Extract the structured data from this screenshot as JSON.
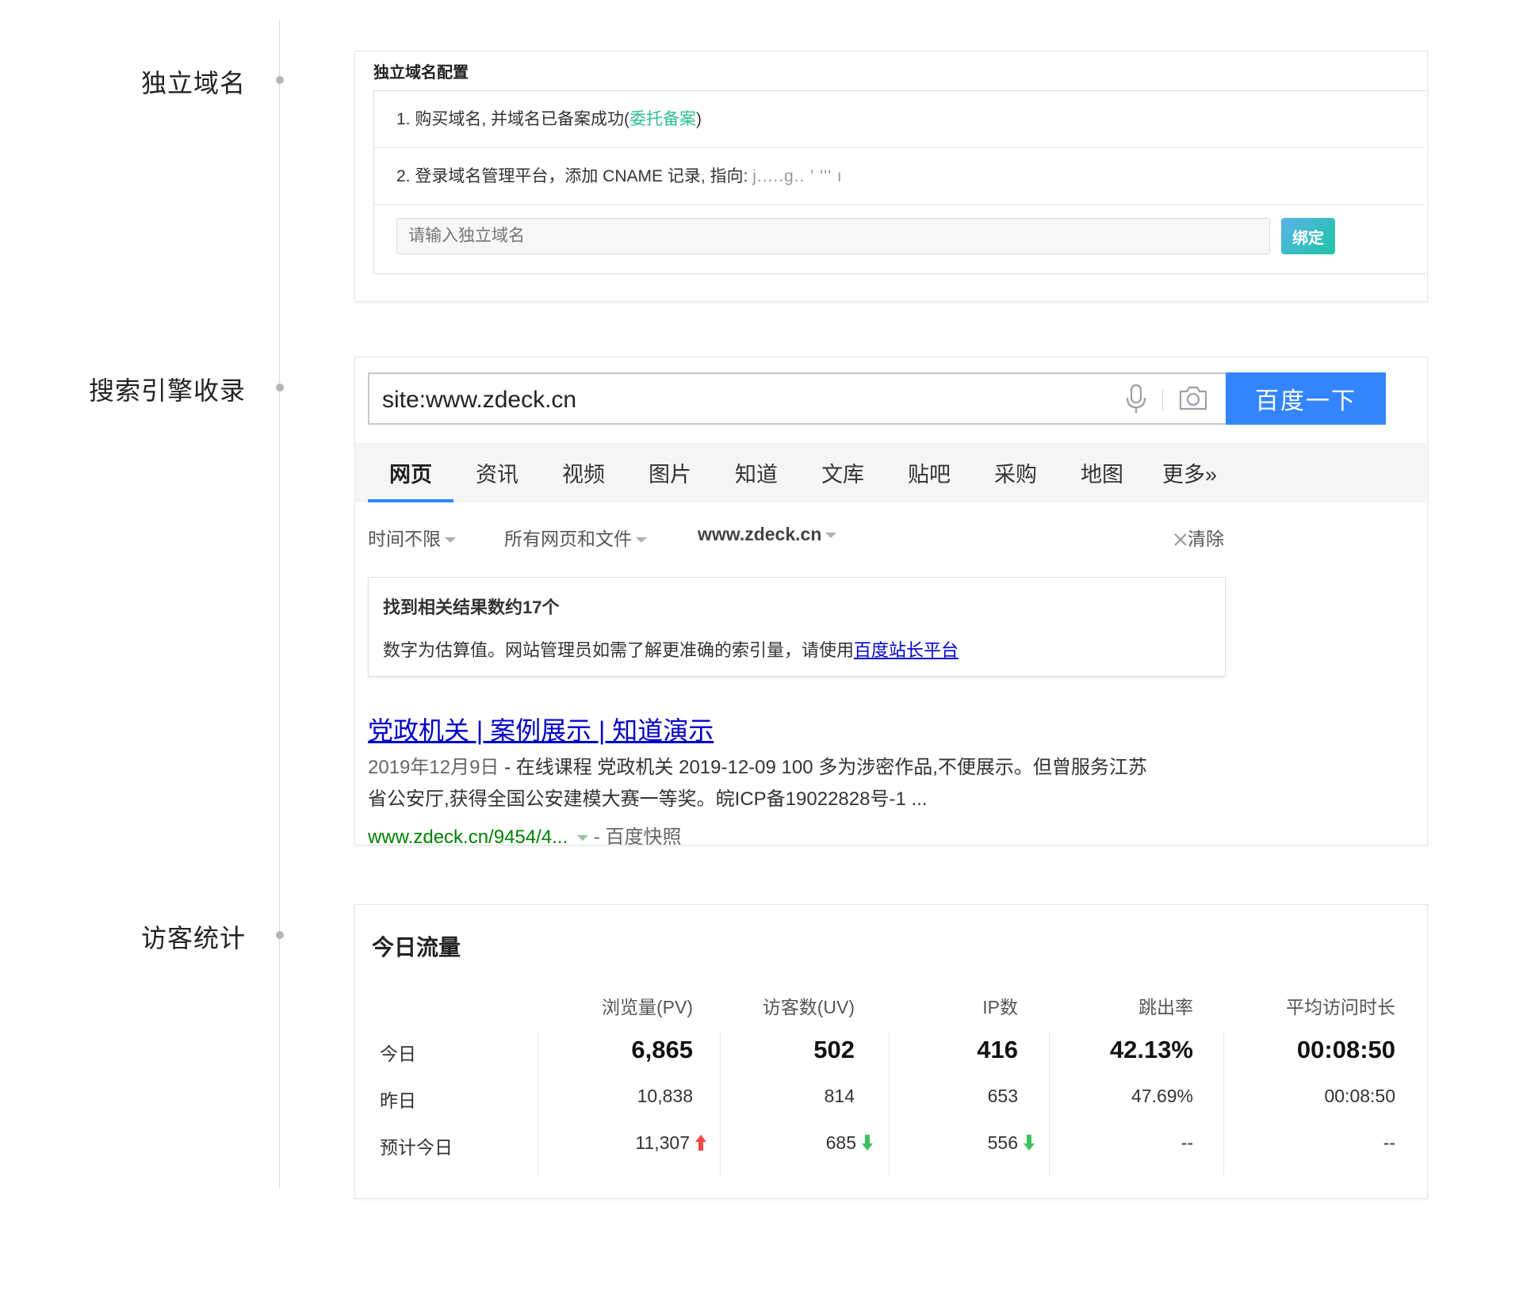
{
  "timeline": {
    "sections": [
      {
        "label": "独立域名"
      },
      {
        "label": "搜索引擎收录"
      },
      {
        "label": "访客统计"
      }
    ]
  },
  "domain": {
    "title": "独立域名配置",
    "step1_prefix": "1. 购买域名, 并域名已备案成功(",
    "step1_link": "委托备案",
    "step1_suffix": ")",
    "step2_prefix": "2. 登录域名管理平台，添加 CNAME 记录, 指向: ",
    "step2_masked": "j.....g..   '  '''       ı",
    "input_placeholder": "请输入独立域名",
    "bind_label": "绑定"
  },
  "baidu": {
    "query": "site:www.zdeck.cn",
    "search_button": "百度一下",
    "tabs": [
      "网页",
      "资讯",
      "视频",
      "图片",
      "知道",
      "文库",
      "贴吧",
      "采购",
      "地图",
      "更多»"
    ],
    "active_tab": "网页",
    "filters": {
      "time": "时间不限",
      "type": "所有网页和文件",
      "site": "www.zdeck.cn",
      "clear": "清除"
    },
    "result_count_title": "找到相关结果数约17个",
    "result_count_desc": "数字为估算值。网站管理员如需了解更准确的索引量，请使用",
    "result_count_link": "百度站长平台",
    "result": {
      "title": "党政机关 | 案例展示 | 知道演示",
      "date": "2019年12月9日",
      "snippet_line1": " - 在线课程 党政机关 2019-12-09 100 多为涉密作品,不便展示。但曾服务江苏",
      "snippet_line2": "省公安厅,获得全国公安建模大赛一等奖。皖ICP备19022828号-1 ...",
      "url": "www.zdeck.cn/9454/4...",
      "dash": " - ",
      "snapshot": "百度快照"
    }
  },
  "stats": {
    "title": "今日流量",
    "columns": [
      "浏览量(PV)",
      "访客数(UV)",
      "IP数",
      "跳出率",
      "平均访问时长"
    ],
    "rows": [
      {
        "label": "今日",
        "values": [
          "6,865",
          "502",
          "416",
          "42.13%",
          "00:08:50"
        ]
      },
      {
        "label": "昨日",
        "values": [
          "10,838",
          "814",
          "653",
          "47.69%",
          "00:08:50"
        ]
      },
      {
        "label": "预计今日",
        "values": [
          "11,307",
          "685",
          "556",
          "--",
          "--"
        ]
      }
    ],
    "trend_colors": {
      "up": "#f04848",
      "down": "#3fbf5f"
    }
  }
}
